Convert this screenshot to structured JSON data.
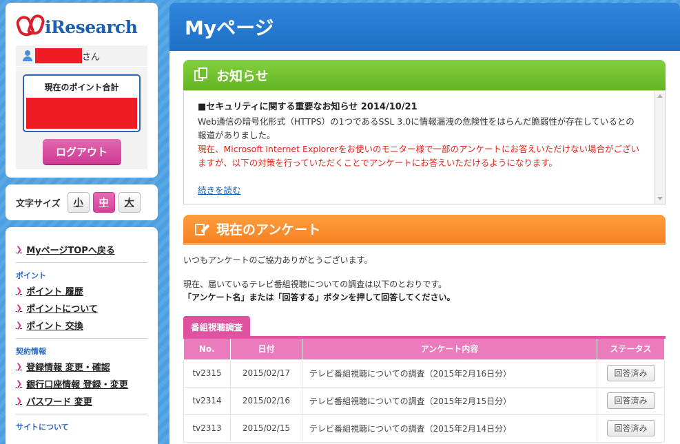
{
  "sidebar": {
    "logo_text": "iResearch",
    "user_suffix": "さん",
    "points_title": "現在のポイント合計",
    "logout_label": "ログアウト",
    "font_size": {
      "label": "文字サイズ",
      "small": "小",
      "medium": "中",
      "large": "大",
      "selected": "中"
    },
    "nav": {
      "top_link": "MyページTOPへ戻る",
      "points_section": "ポイント",
      "points_links": [
        "ポイント 履歴",
        "ポイントについて",
        "ポイント 交換"
      ],
      "contract_section": "契約情報",
      "contract_links": [
        "登録情報 変更・確認",
        "銀行口座情報 登録・変更",
        "パスワード 変更"
      ],
      "site_section": "サイトについて"
    }
  },
  "header": {
    "title": "Myページ"
  },
  "notice": {
    "heading": "お知らせ",
    "title": "■セキュリティに関する重要なお知らせ 2014/10/21",
    "body": "Web通信の暗号化形式（HTTPS）の1つであるSSL 3.0に情報漏洩の危険性をはらんだ脆弱性が存在しているとの報道がありました。",
    "red_text": "現在、Microsoft Internet Explorerをお使いのモニター様で一部のアンケートにお答えいただけない場合がございますが、以下の対策を行っていただくことでアンケートにお答えいただけるようになります。",
    "read_more": "続きを読む"
  },
  "surveys": {
    "heading": "現在のアンケート",
    "intro": "いつもアンケートのご協力ありがとうございます。",
    "instruction": "現在、届いているテレビ番組視聴についての調査は以下のとおりです。",
    "instruction_bold": "「アンケート名」または「回答する」ボタンを押して回答してください。",
    "tab_label": "番組視聴調査",
    "columns": [
      "No.",
      "日付",
      "アンケート内容",
      "ステータス"
    ],
    "rows": [
      {
        "no": "tv2315",
        "date": "2015/02/17",
        "content": "テレビ番組視聴についての調査（2015年2月16日分）",
        "status": "回答済み"
      },
      {
        "no": "tv2314",
        "date": "2015/02/16",
        "content": "テレビ番組視聴についての調査（2015年2月15日分）",
        "status": "回答済み"
      },
      {
        "no": "tv2313",
        "date": "2015/02/15",
        "content": "テレビ番組視聴についての調査（2015年2月14日分）",
        "status": "回答済み"
      }
    ]
  },
  "colors": {
    "accent_blue": "#1f6fc6",
    "green_header": "#6fbe2e",
    "orange_header": "#f58121",
    "pink": "#e0529f",
    "alert_red": "#e2231a"
  }
}
